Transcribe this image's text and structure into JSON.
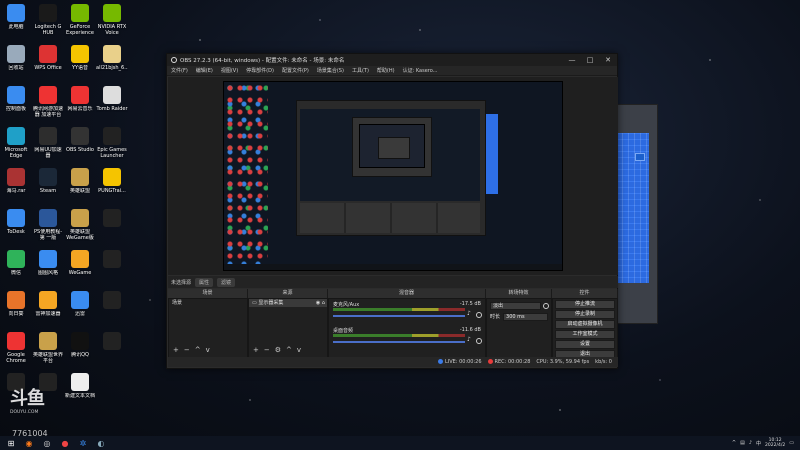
{
  "desktop": {
    "icons": [
      {
        "label": "此电脑",
        "color": "#3a8cf0"
      },
      {
        "label": "Logitech G HUB",
        "color": "#1a1a1a"
      },
      {
        "label": "GeForce Experience",
        "color": "#76b900"
      },
      {
        "label": "NVIDIA RTX Voice",
        "color": "#76b900"
      },
      {
        "label": "回收站",
        "color": "#9ab"
      },
      {
        "label": "WPS Office",
        "color": "#d33"
      },
      {
        "label": "YY语音",
        "color": "#f5c400"
      },
      {
        "label": "all21bjsh_6...",
        "color": "#e9d08a"
      },
      {
        "label": "控制面板",
        "color": "#3a8cf0"
      },
      {
        "label": "腾讯网游加速器 加速平台",
        "color": "#e33"
      },
      {
        "label": "网易云音乐",
        "color": "#e33"
      },
      {
        "label": "Tomb Raider",
        "color": "#ddd"
      },
      {
        "label": "Microsoft Edge",
        "color": "#1fa0c8"
      },
      {
        "label": "网易UU加速器",
        "color": "#2d2d2d"
      },
      {
        "label": "OBS Studio",
        "color": "#333"
      },
      {
        "label": "Epic Games Launcher",
        "color": "#222"
      },
      {
        "label": "海马.rar",
        "color": "#a33"
      },
      {
        "label": "Steam",
        "color": "#1b2838"
      },
      {
        "label": "英雄联盟",
        "color": "#c9a14a"
      },
      {
        "label": "PUNGTrai...",
        "color": "#f5c400"
      },
      {
        "label": "ToDesk",
        "color": "#3a8cf0"
      },
      {
        "label": "PS使用教程-第 一版 2.docx",
        "color": "#2b579a"
      },
      {
        "label": "英雄联盟 WeGame版",
        "color": "#c9a14a"
      },
      {
        "label": "",
        "color": "#222"
      },
      {
        "label": "微信",
        "color": "#2fb35a"
      },
      {
        "label": "图图风格",
        "color": "#3a8cf0"
      },
      {
        "label": "WeGame",
        "color": "#f5a623"
      },
      {
        "label": "",
        "color": "#222"
      },
      {
        "label": "向日葵",
        "color": "#e8742a"
      },
      {
        "label": "雷神加速器",
        "color": "#f5a623"
      },
      {
        "label": "迅雷",
        "color": "#3a8cf0"
      },
      {
        "label": "",
        "color": "#222"
      },
      {
        "label": "Google Chrome",
        "color": "#e33"
      },
      {
        "label": "英雄联盟世界 平台",
        "color": "#c9a14a"
      },
      {
        "label": "腾讯QQ",
        "color": "#111"
      },
      {
        "label": "",
        "color": "#222"
      },
      {
        "label": "",
        "color": "#222"
      },
      {
        "label": "",
        "color": "#222"
      },
      {
        "label": "新建文本文档",
        "color": "#eee"
      }
    ]
  },
  "obs": {
    "title": "OBS 27.2.3 (64-bit, windows) - 配置文件: 未命名 - 场景: 未命名",
    "window_buttons": [
      "—",
      "□",
      "✕"
    ],
    "menu": [
      "文件(F)",
      "编辑(E)",
      "视图(V)",
      "停靠部件(D)",
      "配置文件(P)",
      "场景集合(S)",
      "工具(T)",
      "帮助(H)",
      "认证: Kasero..."
    ],
    "dock_bar": {
      "label": "未选择源",
      "buttons": [
        "属性",
        "滤镜"
      ]
    },
    "dock_headers": [
      "场景",
      "来源",
      "混音器",
      "转场特效",
      "控件"
    ],
    "scenes": {
      "items": [
        "场景"
      ]
    },
    "sources": {
      "items": [
        "显示器采集"
      ]
    },
    "mixer": {
      "channels": [
        {
          "name": "麦克风/Aux",
          "db": "-17.5 dB"
        },
        {
          "name": "桌面音频",
          "db": "-11.6 dB"
        }
      ]
    },
    "transitions": {
      "type": "淡出",
      "duration_label": "时长",
      "duration_value": "300 ms"
    },
    "controls": [
      "停止推流",
      "停止录制",
      "启动虚拟摄像机",
      "工作室模式",
      "设置",
      "退出"
    ],
    "foot_icons": [
      "+",
      "−",
      "^",
      "v"
    ],
    "status": {
      "live": "LIVE: 00:00:26",
      "rec": "REC: 00:00:28",
      "cpu": "CPU: 3.9%, 59.94 fps",
      "kbps": "kb/s: 0"
    },
    "colors": {
      "live_dot": "#3b7be8",
      "rec_dot": "#e83b3b",
      "meter_green": "#3a7d2a",
      "fader_blue": "#4a6ec8"
    }
  },
  "watermark": {
    "logo": "斗鱼",
    "sub": "DOUYU.COM",
    "room_id": "7761004"
  },
  "taskbar": {
    "icons": [
      "windows-start",
      "app-douyu",
      "app-obs",
      "app-chrome",
      "app-settings",
      "app-steam"
    ],
    "tray_time": "10:12",
    "tray_date": "2022/4/2"
  }
}
